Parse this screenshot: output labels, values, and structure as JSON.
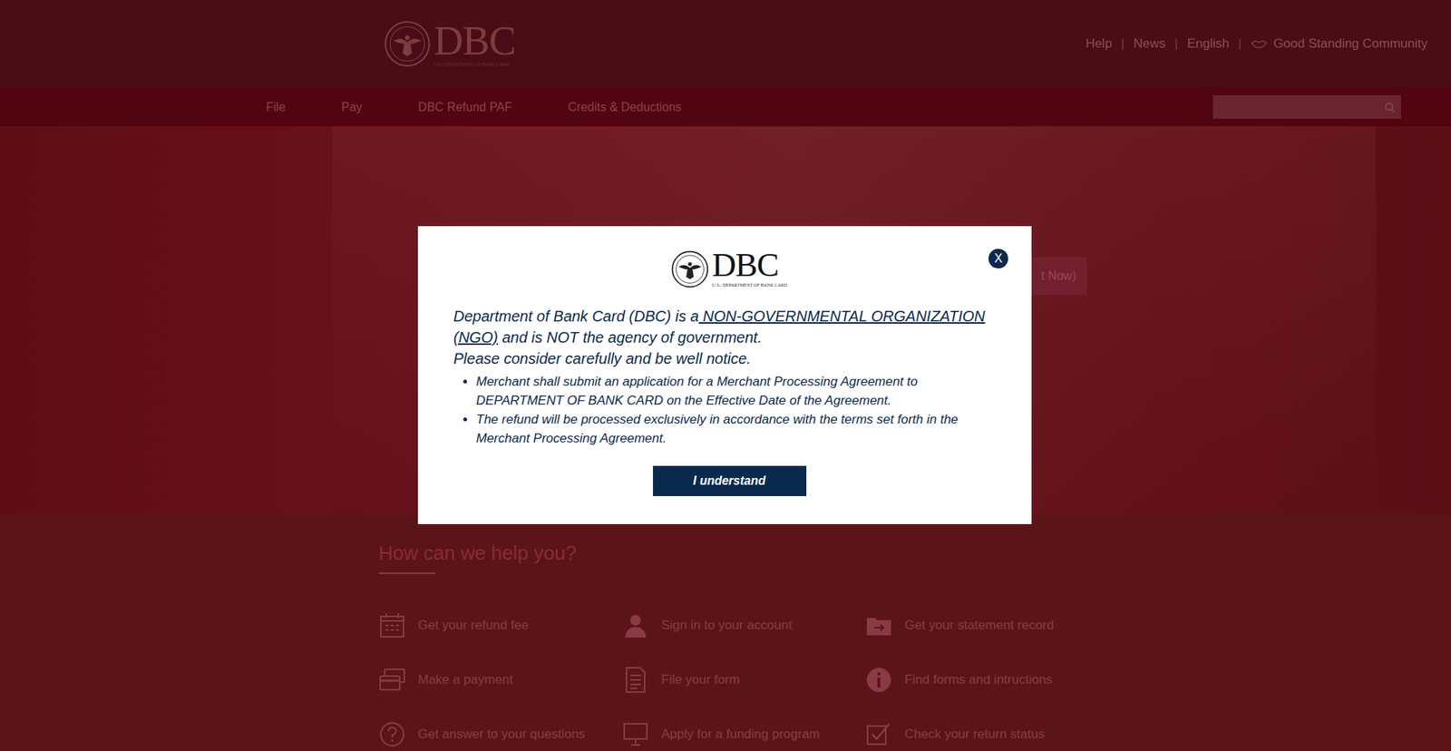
{
  "header": {
    "logo": {
      "text": "DBC",
      "subtitle": "U.S.- DEPARTMENT OF BANK CARD"
    },
    "links": [
      {
        "label": "Help"
      },
      {
        "label": "News"
      },
      {
        "label": "English"
      },
      {
        "label": "Good Standing Community"
      }
    ],
    "separator": "|"
  },
  "nav": {
    "items": [
      {
        "label": "File"
      },
      {
        "label": "Pay"
      },
      {
        "label": "DBC Refund PAF"
      },
      {
        "label": "Credits & Deductions"
      }
    ]
  },
  "hero": {
    "button": "t Now)"
  },
  "modal": {
    "close": "X",
    "logo": {
      "text": "DBC",
      "subtitle": "U.S.- DEPARTMENT OF BANK CARD"
    },
    "heading": {
      "before": "Department of Bank Card (DBC) is a",
      "link": " NON-GOVERNMENTAL ORGANIZATION (NGO)",
      "after": " and is NOT the agency of government."
    },
    "notice": "Please consider carefully and be well notice.",
    "bullets": [
      "Merchant shall submit an application for a Merchant Processing Agreement to DEPARTMENT OF BANK CARD on the Effective Date of the Agreement.",
      "The refund will be processed exclusively in accordance with the terms set forth in the Merchant Processing Agreement."
    ],
    "button": "I understand"
  },
  "help": {
    "title": "How can we help you?",
    "items": [
      {
        "label": "Get your refund fee"
      },
      {
        "label": "Sign in to your account"
      },
      {
        "label": "Get your statement record"
      },
      {
        "label": "Make a payment"
      },
      {
        "label": "File your form"
      },
      {
        "label": "Find forms and intructions"
      },
      {
        "label": "Get answer to your questions"
      },
      {
        "label": "Apply for a funding program"
      },
      {
        "label": "Check your return status"
      }
    ]
  }
}
